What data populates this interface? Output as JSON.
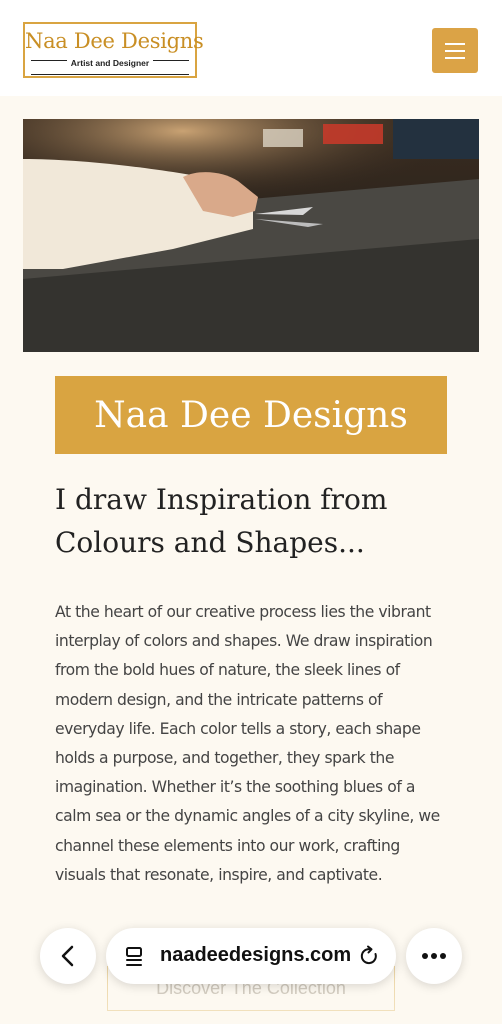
{
  "header": {
    "logo_title": "Naa Dee Designs",
    "logo_subtitle": "Artist and Designer",
    "menu_icon": "hamburger-menu-icon"
  },
  "hero": {
    "image_subject": "person cutting dark fabric with scissors on a work table"
  },
  "main": {
    "title": "Naa Dee Designs",
    "heading_line1": "I draw Inspiration from",
    "heading_line2": "Colours and Shapes...",
    "paragraph": "At the heart of our creative process lies the vibrant interplay of colors and shapes. We draw inspiration from the bold hues of nature, the sleek lines of modern design, and the intricate patterns of everyday life. Each color tells a story, each shape holds a purpose, and together, they spark the imagination. Whether it’s the soothing blues of a calm sea or the dynamic angles of a city skyline, we channel these elements into our work, crafting visuals that resonate, inspire, and captivate.",
    "cta_label": "Discover The Collection"
  },
  "browser": {
    "url": "naadeedesigns.com",
    "back_icon": "back-arrow-icon",
    "tabs_icon": "page-tabs-icon",
    "reload_icon": "reload-icon",
    "more_icon": "more-dots-icon"
  },
  "colors": {
    "accent": "#d9a441",
    "background": "#fdf9f1",
    "text": "#222222"
  }
}
